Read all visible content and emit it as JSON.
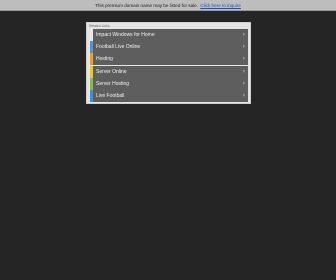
{
  "notice": {
    "text": "This premium domain name may be listed for sale.",
    "link_text": "Click here to inquire"
  },
  "panel": {
    "header": "Related Links",
    "accent_colors": [
      "#e9e9e9",
      "#5b8fd6",
      "#f0a020",
      "#f0c81e",
      "#7cc04a",
      "#3f8fe0",
      "#48b8a0"
    ],
    "links": [
      {
        "label": "Impact Windows for Home",
        "icon": "chevron-right-icon"
      },
      {
        "label": "Football Live Online",
        "icon": "chevron-right-icon"
      },
      {
        "label": "Hosting",
        "icon": "chevron-right-icon"
      },
      {
        "label": "Server Online",
        "icon": "chevron-right-icon"
      },
      {
        "label": "Server Hosting",
        "icon": "chevron-right-icon"
      },
      {
        "label": "Live Football",
        "icon": "chevron-right-icon"
      }
    ]
  }
}
